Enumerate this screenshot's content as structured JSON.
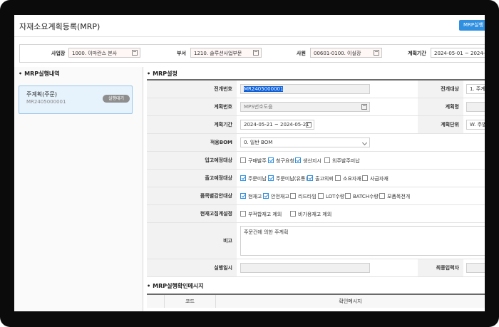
{
  "window": {
    "title": "자재소요계획등록(MRP)",
    "run_button": "MRP실행"
  },
  "filters": {
    "business_label": "사업장",
    "business_value": "1000. 이마란스 본사",
    "dept_label": "부서",
    "dept_value": "1210. 솔루션사업부문",
    "employee_label": "사원",
    "employee_value": "00601-0100. 이실장",
    "period_label": "계획기간",
    "period_value": "2024-05-01 ~ 2024-05-31"
  },
  "left": {
    "section_title": "MRP실행내역",
    "card_title": "주계획(주문)",
    "card_code": "MR2405000001",
    "card_badge": "실행대기"
  },
  "settings": {
    "section_title": "MRP설정",
    "deploy_no_label": "전개번호",
    "deploy_no_value": "MR2405000001",
    "deploy_target_label": "전개대상",
    "deploy_target_value": "1. 주계",
    "plan_no_label": "계획번호",
    "plan_no_placeholder": "MPS번호도움",
    "plan_name_label": "계획명",
    "plan_period_label": "계획기간",
    "plan_period_value": "2024-05-21 ~ 2024-05-21",
    "plan_unit_label": "계획단위",
    "plan_unit_value": "W. 주별",
    "bom_label": "적용BOM",
    "bom_value": "0. 일반 BOM",
    "in_label": "입고예정대상",
    "in_options": [
      {
        "label": "구매발주",
        "checked": false
      },
      {
        "label": "청구요청",
        "checked": true
      },
      {
        "label": "생산지시",
        "checked": true
      },
      {
        "label": "외주발주미납",
        "checked": false
      }
    ],
    "out_label": "출고예정대상",
    "out_options": [
      {
        "label": "주문미납",
        "checked": true
      },
      {
        "label": "주문미납(유통)",
        "checked": true
      },
      {
        "label": "출고의뢰",
        "checked": true
      },
      {
        "label": "소요자재",
        "checked": false
      },
      {
        "label": "사급자재",
        "checked": false
      }
    ],
    "item_label": "품목별감안대상",
    "item_options": [
      {
        "label": "현재고",
        "checked": true
      },
      {
        "label": "안전재고",
        "checked": true
      },
      {
        "label": "리드타임",
        "checked": false
      },
      {
        "label": "LOT수량",
        "checked": false
      },
      {
        "label": "BATCH수량",
        "checked": false
      },
      {
        "label": "모품목전개",
        "checked": false
      }
    ],
    "stock_label": "현재고집계설정",
    "stock_options": [
      {
        "label": "부적합재고 제외",
        "checked": false
      },
      {
        "label": "비가용재고 제외",
        "checked": false
      }
    ],
    "note_label": "비고",
    "note_value": "주문건에 의한 주계획",
    "run_date_label": "실행일시",
    "final_user_label": "최종입력자"
  },
  "confirm": {
    "section_title": "MRP실행확인메시지",
    "col_code": "코드",
    "col_message": "확인메시지"
  }
}
